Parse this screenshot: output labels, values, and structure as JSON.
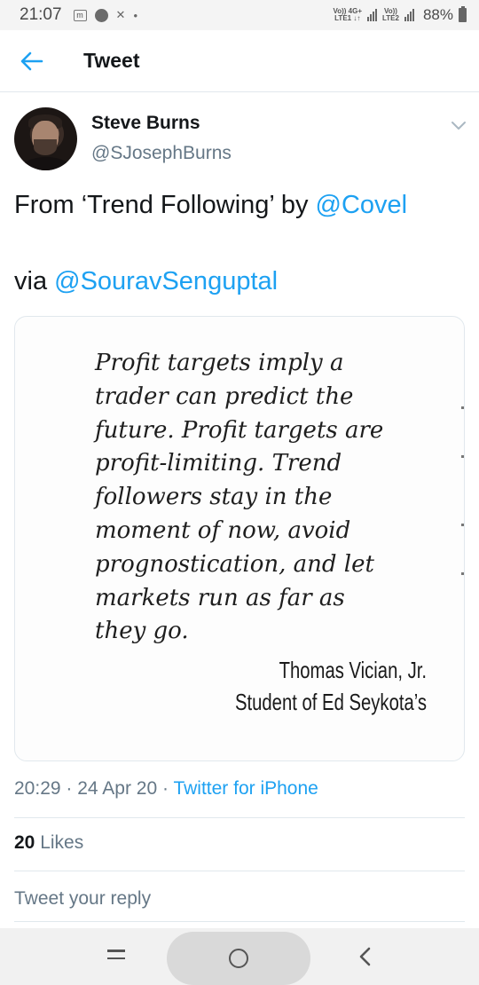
{
  "status_bar": {
    "time": "21:07",
    "sim1_label": "VoLTE1 4G+",
    "sim2_label": "VoLTE2",
    "battery": "88%"
  },
  "header": {
    "title": "Tweet",
    "back_icon": "arrow-left-icon"
  },
  "tweet": {
    "author": {
      "display_name": "Steve Burns",
      "handle": "@SJosephBurns"
    },
    "text_prefix": "From ‘Trend Following’ by ",
    "mention_1": "@Covel",
    "text_via": "via ",
    "mention_2": "@SouravSenguptal",
    "quote_lines": [
      "Profit targets imply a",
      "trader can predict the",
      "future. Profit targets are",
      "profit-limiting. Trend",
      "followers stay in the",
      "moment of now, avoid",
      "prognostication, and let",
      "markets run as far as",
      "they go."
    ],
    "attribution_name": "Thomas Vician, Jr.",
    "attribution_role": "Student of Ed Seykota’s",
    "time": "20:29",
    "date": "24 Apr 20",
    "source": "Twitter for iPhone",
    "likes_count": "20",
    "likes_label": "Likes",
    "reply_placeholder": "Tweet your reply"
  },
  "colors": {
    "link": "#1da1f2",
    "secondary_text": "#657786",
    "divider": "#e1e8ed"
  }
}
